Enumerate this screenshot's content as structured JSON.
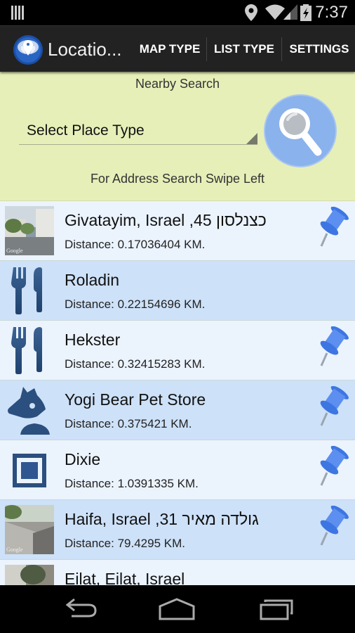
{
  "status_bar": {
    "time": "7:37",
    "icons": [
      "notification-bars-icon",
      "location-icon",
      "wifi-icon",
      "signal-icon",
      "battery-charging-icon"
    ]
  },
  "action_bar": {
    "app_title": "Locatio...",
    "buttons": [
      {
        "label": "MAP TYPE"
      },
      {
        "label": "LIST TYPE"
      },
      {
        "label": "SETTINGS"
      }
    ]
  },
  "search_panel": {
    "title": "Nearby Search",
    "place_type_select": "Select Place Type",
    "hint": "For Address Search Swipe Left",
    "search_button_icon": "magnifier-icon"
  },
  "places": [
    {
      "title": "Givatayim, Israel ,45 כצנלסון",
      "distance": "Distance: 0.17036404 KM.",
      "thumb": "street-view-photo",
      "pinned": true
    },
    {
      "title": "Roladin",
      "distance": "Distance: 0.22154696 KM.",
      "thumb": "restaurant-icon",
      "pinned": false
    },
    {
      "title": "Hekster",
      "distance": "Distance: 0.32415283 KM.",
      "thumb": "restaurant-icon",
      "pinned": true
    },
    {
      "title": "Yogi Bear Pet Store",
      "distance": "Distance: 0.375421 KM.",
      "thumb": "pet-store-icon",
      "pinned": true
    },
    {
      "title": "Dixie",
      "distance": "Distance: 1.0391335 KM.",
      "thumb": "generic-place-icon",
      "pinned": true
    },
    {
      "title": "Haifa, Israel ,31 גולדה מאיר",
      "distance": "Distance: 79.4295 KM.",
      "thumb": "street-view-photo",
      "pinned": true
    },
    {
      "title": "Eilat, Eilat, Israel",
      "distance": "",
      "thumb": "street-view-photo",
      "pinned": false
    }
  ],
  "colors": {
    "action_bar": "#222222",
    "search_panel": "#e6efb8",
    "row_light": "#ebf3fd",
    "row_dark": "#cde1f8",
    "icon_blue": "#2b4f7e",
    "pin_blue": "#3f7ee8"
  }
}
